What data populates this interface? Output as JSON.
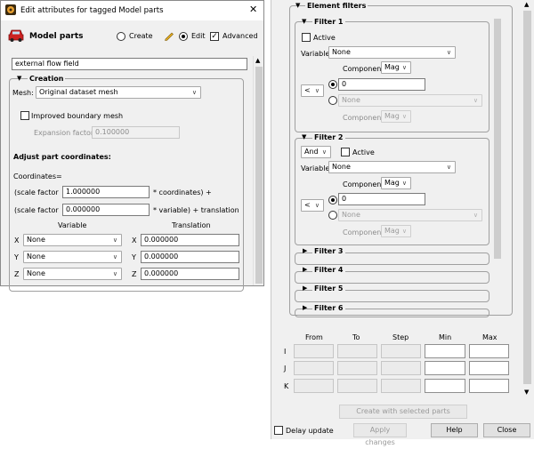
{
  "dialog": {
    "title": "Edit attributes for tagged Model parts",
    "close_glyph": "✕",
    "header_title": "Model parts",
    "mode_create": "Create",
    "mode_edit": "Edit",
    "advanced": "Advanced",
    "part_name": "external flow field",
    "creation_label": "Creation",
    "mesh_label": "Mesh:",
    "mesh_value": "Original dataset mesh",
    "improved_boundary": "Improved boundary mesh",
    "expansion_label": "Expansion factor",
    "expansion_value": "0.100000",
    "adjust_heading": "Adjust part coordinates:",
    "coordinates_label": "Coordinates=",
    "scale1_label": "(scale factor",
    "scale1_value": "1.000000",
    "scale1_suffix": "* coordinates) +",
    "scale2_label": "(scale factor",
    "scale2_value": "0.000000",
    "scale2_suffix": "* variable) + translation",
    "col_variable": "Variable",
    "col_translation": "Translation",
    "rows": [
      {
        "axis": "X",
        "variable": "None",
        "t_axis": "X",
        "translation": "0.000000"
      },
      {
        "axis": "Y",
        "variable": "None",
        "t_axis": "Y",
        "translation": "0.000000"
      },
      {
        "axis": "Z",
        "variable": "None",
        "t_axis": "Z",
        "translation": "0.000000"
      }
    ]
  },
  "right": {
    "element_filters": "Element filters",
    "filter1": {
      "title": "Filter 1",
      "active": "Active",
      "variable_label": "Variable",
      "variable_value": "None",
      "component_label": "Component",
      "component_value": "Mag",
      "op": "<",
      "value": "0",
      "alt_value": "None",
      "component2_label": "Component",
      "component2_value": "Mag"
    },
    "filter2": {
      "title": "Filter 2",
      "logic": "And",
      "active": "Active",
      "variable_label": "Variable",
      "variable_value": "None",
      "component_label": "Component",
      "component_value": "Mag",
      "op": "<",
      "value": "0",
      "alt_value": "None",
      "component2_label": "Component",
      "component2_value": "Mag"
    },
    "collapsed_filters": [
      "Filter 3",
      "Filter 4",
      "Filter 5",
      "Filter 6"
    ],
    "grid_headers": [
      "From",
      "To",
      "Step",
      "Min",
      "Max"
    ],
    "grid_rows": [
      "I",
      "J",
      "K"
    ],
    "create_button": "Create with selected parts",
    "delay_update": "Delay update",
    "apply_changes": "Apply changes",
    "help": "Help",
    "close": "Close"
  },
  "colors": {
    "accent": "#cc2222",
    "window_bg": "#f0f0f0",
    "scroll_bg": "#f0f0f0"
  }
}
